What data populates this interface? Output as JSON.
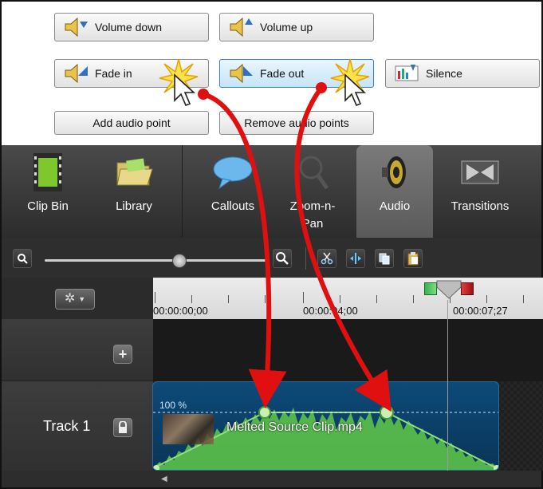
{
  "audio_buttons": {
    "volume_down": "Volume down",
    "volume_up": "Volume up",
    "fade_in": "Fade in",
    "fade_out": "Fade out",
    "silence": "Silence",
    "add_audio_point": "Add audio point",
    "remove_audio_points": "Remove audio points"
  },
  "tabs": [
    {
      "label": "Clip Bin",
      "icon": "film-strip-icon"
    },
    {
      "label": "Library",
      "icon": "folder-icon"
    },
    {
      "label": "Callouts",
      "icon": "speech-bubble-icon"
    },
    {
      "label": "Zoom-n-\nPan",
      "icon": "magnifier-icon"
    },
    {
      "label": "Audio",
      "icon": "speaker-icon",
      "active": true
    },
    {
      "label": "Transitions",
      "icon": "transition-icon"
    }
  ],
  "ruler": {
    "times": [
      "00:00:00;00",
      "00:00:04;00",
      "00:00:07;27"
    ]
  },
  "track": {
    "name": "Track 1",
    "clip_name": "Melted Source Clip.mp4",
    "volume_label": "100 %"
  },
  "colors": {
    "annotation_arrow": "#e01010",
    "waveform": "#5cc24a",
    "clip_background": "#0d4a78"
  }
}
